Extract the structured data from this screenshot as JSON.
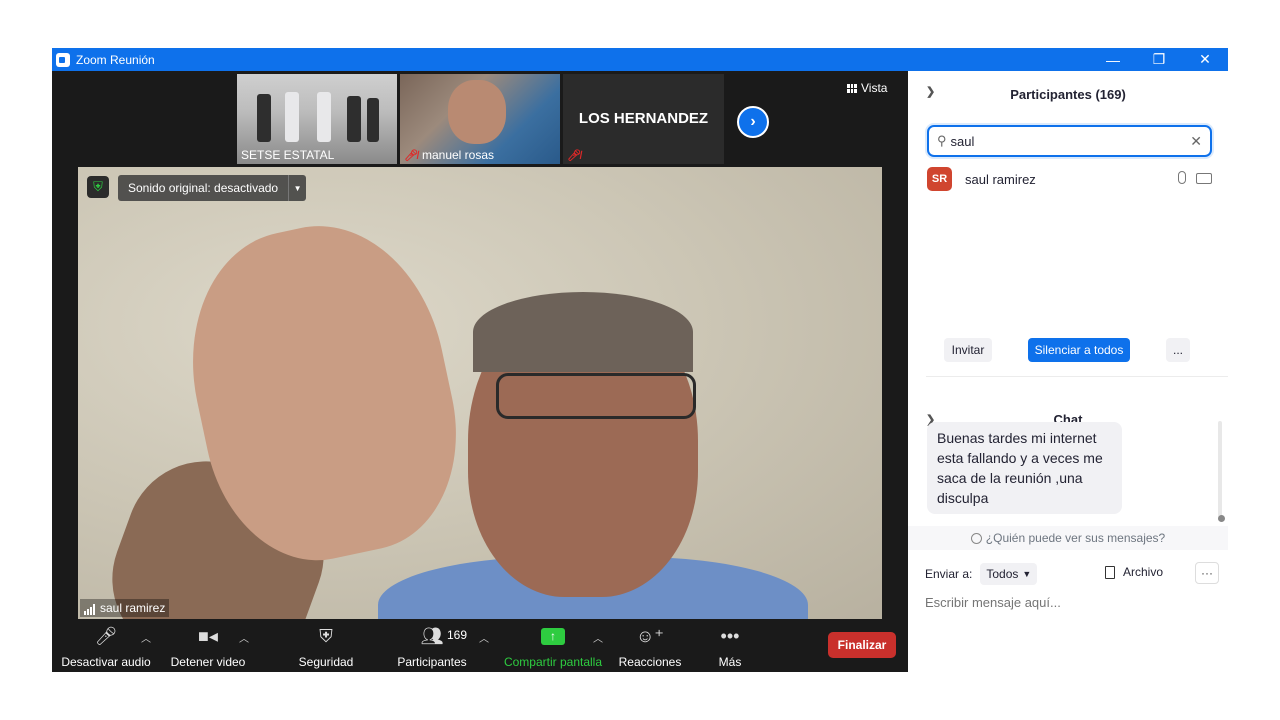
{
  "window": {
    "title": "Zoom Reunión",
    "controls": [
      "—",
      "❐",
      "✕"
    ]
  },
  "strip": {
    "thumbs": [
      {
        "name": "SETSE ESTATAL"
      },
      {
        "name": "manuel rosas"
      },
      {
        "name": "LOS HERNANDEZ"
      }
    ],
    "view_label": "Vista"
  },
  "video": {
    "sound_label": "Sonido original: desactivado",
    "speaker": "saul ramirez"
  },
  "toolbar": {
    "audio": "Desactivar audio",
    "video": "Detener video",
    "security": "Seguridad",
    "participants": "Participantes",
    "participants_count": "169",
    "share": "Compartir pantalla",
    "reactions": "Reacciones",
    "more": "Más",
    "end": "Finalizar"
  },
  "participants_panel": {
    "title": "Participantes (169)",
    "search_value": "saul",
    "results": [
      {
        "initials": "SR",
        "name": "saul ramirez",
        "avatar_color": "#d0452f"
      }
    ],
    "invite": "Invitar",
    "mute_all": "Silenciar a todos",
    "more": "..."
  },
  "chat_panel": {
    "title": "Chat",
    "messages": [
      {
        "text": "Buenas tardes mi internet esta fallando y a veces me saca de la reunión ,una disculpa"
      }
    ],
    "who_can_see": "¿Quién puede ver sus mensajes?",
    "send_to_label": "Enviar a:",
    "send_to_value": "Todos",
    "file_label": "Archivo",
    "input_placeholder": "Escribir mensaje aquí..."
  },
  "colors": {
    "accent": "#0e71eb",
    "end": "#c9302c",
    "share": "#2ecc40"
  }
}
